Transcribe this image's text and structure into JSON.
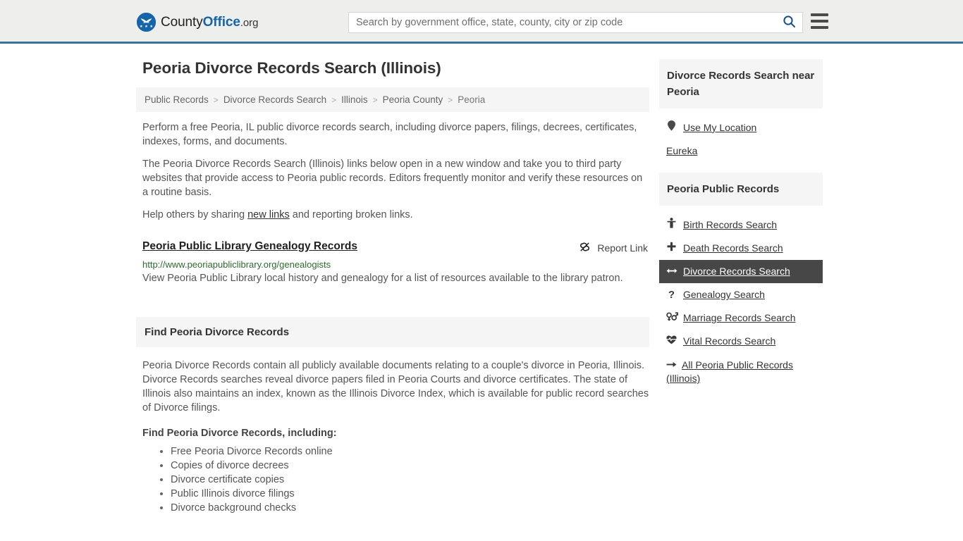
{
  "header": {
    "brand": {
      "part1": "County",
      "part2": "Office",
      "part3": ".org",
      "logo_icon": "eagle-star-logo-icon"
    },
    "search": {
      "placeholder": "Search by government office, state, county, city or zip code",
      "value": "",
      "icon": "search-icon"
    },
    "menu_icon": "hamburger-menu-icon",
    "accent_color": "#36749d"
  },
  "main": {
    "title": "Peoria Divorce Records Search (Illinois)",
    "breadcrumb": {
      "separator": ">",
      "items": [
        {
          "label": "Public Records"
        },
        {
          "label": "Divorce Records Search"
        },
        {
          "label": "Illinois"
        },
        {
          "label": "Peoria County"
        },
        {
          "label": "Peoria"
        }
      ]
    },
    "intro_paragraphs": [
      "Perform a free Peoria, IL public divorce records search, including divorce papers, filings, decrees, certificates, indexes, forms, and documents.",
      "The Peoria Divorce Records Search (Illinois) links below open in a new window and take you to third party websites that provide access to Peoria public records. Editors frequently monitor and verify these resources on a routine basis."
    ],
    "help_line": {
      "before": "Help others by sharing ",
      "link": "new links",
      "after": " and reporting broken links."
    },
    "result": {
      "title": "Peoria Public Library Genealogy Records",
      "url": "http://www.peoriapubliclibrary.org/genealogists",
      "description": "View Peoria Public Library local history and genealogy for a list of resources available to the library patron.",
      "report_label": "Report Link",
      "report_icon": "broken-link-icon",
      "url_color": "#2e6b2e"
    },
    "section": {
      "heading": "Find Peoria Divorce Records",
      "paragraph": "Peoria Divorce Records contain all publicly available documents relating to a couple's divorce in Peoria, Illinois. Divorce Records searches reveal divorce papers filed in Peoria Courts and divorce certificates. The state of Illinois also maintains an index, known as the Illinois Divorce Index, which is available for public record searches of Divorce filings.",
      "sub_heading": "Find Peoria Divorce Records, including:",
      "bullets": [
        "Free Peoria Divorce Records online",
        "Copies of divorce decrees",
        "Divorce certificate copies",
        "Public Illinois divorce filings",
        "Divorce background checks"
      ]
    }
  },
  "sidebar": {
    "near_panel": {
      "heading": "Divorce Records Search near Peoria",
      "items": [
        {
          "label": "Use My Location",
          "icon": "map-pin-icon",
          "has_icon": true
        },
        {
          "label": "Eureka",
          "icon": "",
          "has_icon": false
        }
      ]
    },
    "records_panel": {
      "heading": "Peoria Public Records",
      "active_color": "#474747",
      "items": [
        {
          "label": "Birth Records Search",
          "icon": "child-icon",
          "glyph": "Ɣ",
          "active": false
        },
        {
          "label": "Death Records Search",
          "icon": "cross-plus-icon",
          "glyph": "+",
          "active": false
        },
        {
          "label": "Divorce Records Search",
          "icon": "left-right-arrows-icon",
          "glyph": "↔",
          "active": true
        },
        {
          "label": "Genealogy Search",
          "icon": "question-mark-icon",
          "glyph": "?",
          "active": false
        },
        {
          "label": "Marriage Records Search",
          "icon": "venus-mars-icon",
          "glyph": "⚥",
          "active": false
        },
        {
          "label": "Vital Records Search",
          "icon": "heartbeat-icon",
          "glyph": "♥",
          "active": false
        },
        {
          "label": "All Peoria Public Records (Illinois)",
          "icon": "arrow-right-icon",
          "glyph": "→",
          "active": false
        }
      ]
    }
  }
}
